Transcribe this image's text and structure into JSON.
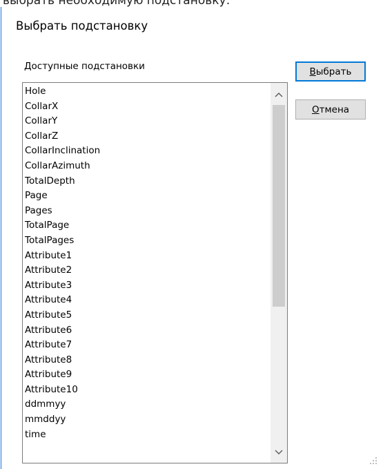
{
  "top_banner": "выбрать необходимую подстановку:",
  "dialog": {
    "title": "Выбрать подстановку",
    "list_label": "Доступные подстановки",
    "items": [
      "Hole",
      "CollarX",
      "CollarY",
      "CollarZ",
      "CollarInclination",
      "CollarAzimuth",
      "TotalDepth",
      "Page",
      "Pages",
      "TotalPage",
      "TotalPages",
      "Attribute1",
      "Attribute2",
      "Attribute3",
      "Attribute4",
      "Attribute5",
      "Attribute6",
      "Attribute7",
      "Attribute8",
      "Attribute9",
      "Attribute10",
      "ddmmyy",
      "mmddyy",
      "time"
    ],
    "buttons": {
      "select": {
        "mnemonic": "В",
        "rest": "ыбрать"
      },
      "cancel": {
        "mnemonic": "О",
        "rest": "тмена"
      }
    }
  },
  "icons": {
    "scroll_up": "chevron-up-icon",
    "scroll_down": "chevron-down-icon",
    "resize_grip": "resize-grip-icon"
  },
  "colors": {
    "accent": "#0078d7",
    "button_bg": "#e1e1e1",
    "scroll_thumb": "#cdcdcd",
    "window_edge": "#1a73d9"
  }
}
